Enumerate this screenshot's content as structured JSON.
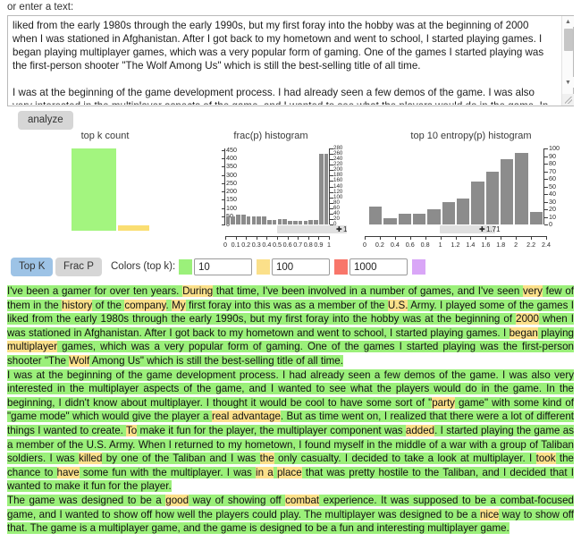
{
  "labels": {
    "enter_text": "or enter a text:",
    "analyze": "analyze",
    "colors_label": "Colors (top k):"
  },
  "textarea": {
    "paragraph1": "liked from the early 1980s through the early 1990s, but my first foray into the hobby was at the beginning of 2000 when I was stationed in Afghanistan. After I got back to my hometown and went to school, I started playing games. I began playing multiplayer games, which was a very popular form of gaming. One of the games I started playing was the first-person shooter \"The Wolf Among Us\" which is still the best-selling title of all time.",
    "paragraph2": "I was at the beginning of the game development process. I had already seen a few demos of the game. I was also very interested in the multiplayer aspects of the game, and I wanted to see what the players would do in the game. In the"
  },
  "toggles": {
    "top_k": "Top K",
    "frac_p": "Frac P",
    "top_k_color": "#9dc3e6",
    "frac_p_color": "#d6d6d6"
  },
  "color_inputs": [
    {
      "swatch": "#9bf07a",
      "value": "10"
    },
    {
      "swatch": "#fbe08a",
      "value": "100"
    },
    {
      "swatch": "#f8766a",
      "value": "1000"
    },
    {
      "swatch": "#d9a6f7",
      "value": ""
    }
  ],
  "chart_data": [
    {
      "type": "bar",
      "title": "top k count",
      "categories": [
        "10",
        "100"
      ],
      "values": [
        450,
        28
      ],
      "colors": [
        "#a3f57f",
        "#fade72"
      ],
      "ylim": [
        0,
        460
      ],
      "xlabel": "",
      "ylabel": "",
      "grid": false
    },
    {
      "type": "bar",
      "title": "frac(p) histogram",
      "xlabel": "frac(p)",
      "ylabel": "count",
      "left_axis_ticks": [
        0,
        50,
        100,
        150,
        200,
        250,
        300,
        350,
        400,
        450
      ],
      "right_axis_ticks": [
        0,
        20,
        40,
        60,
        80,
        100,
        120,
        140,
        160,
        180,
        200,
        220,
        240,
        260,
        280
      ],
      "x_tick_labels": [
        "0",
        "0.1",
        "0.2",
        "0.3",
        "0.4",
        "0.5",
        "0.6",
        "0.7",
        "0.8",
        "0.9",
        "1"
      ],
      "xlim": [
        0,
        1
      ],
      "ylim": [
        0,
        460
      ],
      "bins": [
        0.05,
        0.1,
        0.15,
        0.2,
        0.25,
        0.3,
        0.35,
        0.4,
        0.45,
        0.5,
        0.55,
        0.6,
        0.65,
        0.7,
        0.75,
        0.8,
        0.85,
        0.9,
        0.95,
        1.0
      ],
      "values": [
        47,
        47,
        62,
        62,
        50,
        50,
        47,
        47,
        28,
        28,
        30,
        30,
        20,
        20,
        24,
        24,
        29,
        29,
        425,
        425
      ],
      "slider_value": "1",
      "slider_pos": 1.0,
      "grid": false
    },
    {
      "type": "bar",
      "title": "top 10 entropy(p) histogram",
      "xlabel": "entropy(p)",
      "ylabel": "count",
      "right_axis_ticks": [
        0,
        10,
        20,
        30,
        40,
        50,
        60,
        70,
        80,
        90,
        100
      ],
      "x_tick_labels": [
        "0",
        "0.2",
        "0.4",
        "0.6",
        "0.8",
        "1",
        "1.2",
        "1.4",
        "1.6",
        "1.8",
        "2",
        "2.2",
        "2.4"
      ],
      "xlim": [
        0,
        2.4
      ],
      "ylim": [
        0,
        100
      ],
      "bin_centers": [
        0.1,
        0.3,
        0.5,
        0.7,
        0.9,
        1.1,
        1.3,
        1.5,
        1.7,
        1.9,
        2.1,
        2.3
      ],
      "values": [
        24,
        8,
        14,
        14,
        20,
        29,
        34,
        57,
        70,
        86,
        94,
        16
      ],
      "slider_value": "1.71",
      "slider_pos": 1.71,
      "grid": false
    }
  ],
  "annotated_text": {
    "paragraphs": [
      [
        {
          "t": "I've been a gamer for over ten years. ",
          "h": "g"
        },
        {
          "t": "During",
          "h": "y"
        },
        {
          "t": " that time, I've been involved in a number of games, and I've seen ",
          "h": "g"
        },
        {
          "t": "very",
          "h": "y"
        },
        {
          "t": " few of them in the ",
          "h": "g"
        },
        {
          "t": "history",
          "h": "y"
        },
        {
          "t": " of the ",
          "h": "g"
        },
        {
          "t": "company",
          "h": "y"
        },
        {
          "t": ". ",
          "h": "g"
        },
        {
          "t": "My",
          "h": "y"
        },
        {
          "t": " first foray into this was as a member of the ",
          "h": "g"
        },
        {
          "t": "U.S.",
          "h": "y"
        },
        {
          "t": " Army. I played some of the games I liked from the early 1980s through the early 1990s, but my first foray into the hobby was at the beginning of ",
          "h": "g"
        },
        {
          "t": "2000",
          "h": "y"
        },
        {
          "t": " when I was stationed in Afghanistan. After I got back to my hometown and went to school, I started playing games. I ",
          "h": "g"
        },
        {
          "t": "began",
          "h": "y"
        },
        {
          "t": " playing ",
          "h": "g"
        },
        {
          "t": "multiplayer",
          "h": "y"
        },
        {
          "t": " games, which was a very popular form of gaming. One of the games I started playing was the first-person shooter \"The ",
          "h": "g"
        },
        {
          "t": "Wolf",
          "h": "y"
        },
        {
          "t": " Among Us\" which is still the best-selling title of all time.",
          "h": "g"
        }
      ],
      [
        {
          "t": "I was at the beginning of the game development process. I had already seen a few demos of the game. I was also very interested in the multiplayer aspects of the game, and I wanted to see what the players would do in the game. In the beginning, I didn't know about multiplayer. I thought it would be cool to have some sort of \"",
          "h": "g"
        },
        {
          "t": "party",
          "h": "y"
        },
        {
          "t": " game\" with some kind of \"game mode\" which would give the player a ",
          "h": "g"
        },
        {
          "t": "real advantage",
          "h": "y"
        },
        {
          "t": ". But as time went on, I realized that there were a lot of different things I wanted to create. ",
          "h": "g"
        },
        {
          "t": "To",
          "h": "y"
        },
        {
          "t": " make it fun for the player, the multiplayer component was ",
          "h": "g"
        },
        {
          "t": "added",
          "h": "y"
        },
        {
          "t": ". I started playing the game as a member of the U.S. Army. When I returned to my hometown, I found myself in the middle of a war with a group of Taliban soldiers. I was ",
          "h": "g"
        },
        {
          "t": "killed",
          "h": "y"
        },
        {
          "t": " by one of the Taliban and I was ",
          "h": "g"
        },
        {
          "t": "the",
          "h": "y"
        },
        {
          "t": " only casualty. I decided to take a look at multiplayer. I ",
          "h": "g"
        },
        {
          "t": "took",
          "h": "y"
        },
        {
          "t": " the chance to ",
          "h": "g"
        },
        {
          "t": "have",
          "h": "y"
        },
        {
          "t": " some fun with the multiplayer. I was ",
          "h": "g"
        },
        {
          "t": "in a",
          "h": "y"
        },
        {
          "t": " ",
          "h": "g"
        },
        {
          "t": "place",
          "h": "y"
        },
        {
          "t": " that was pretty hostile to the Taliban, and I decided that I wanted to make it fun for the player.",
          "h": "g"
        }
      ],
      [
        {
          "t": "The game was designed to be a ",
          "h": "g"
        },
        {
          "t": "good",
          "h": "y"
        },
        {
          "t": " way of showing off ",
          "h": "g"
        },
        {
          "t": "combat",
          "h": "y"
        },
        {
          "t": " experience. It was supposed to be a combat-focused game, and I wanted to show off how well the players could play. The multiplayer was designed to be a ",
          "h": "g"
        },
        {
          "t": "nice",
          "h": "y"
        },
        {
          "t": " way to show off that. The game is a multiplayer game, and the game is designed to be a fun and interesting multiplayer game.",
          "h": "g"
        }
      ]
    ]
  }
}
